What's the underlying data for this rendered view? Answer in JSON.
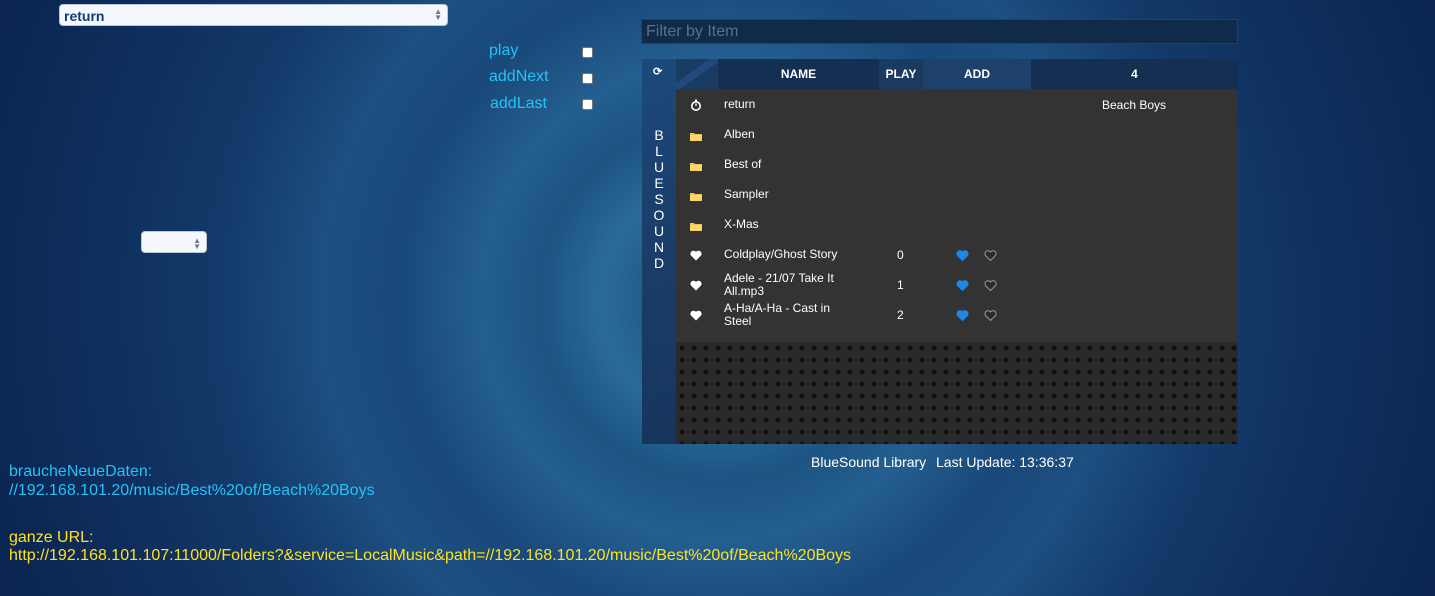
{
  "top_select": {
    "value": "return"
  },
  "small_select": {
    "value": ""
  },
  "options": [
    {
      "label": "play"
    },
    {
      "label": "addNext"
    },
    {
      "label": "addLast"
    }
  ],
  "filter": {
    "placeholder": "Filter by Item"
  },
  "side_label": [
    "B",
    "L",
    "U",
    "E",
    "S",
    "O",
    "U",
    "N",
    "D"
  ],
  "table": {
    "headers": {
      "name": "NAME",
      "play": "PLAY",
      "add": "ADD",
      "count": "4"
    },
    "rows": [
      {
        "icon": "stopwatch-icon",
        "name": "return",
        "play": "",
        "extra": "Beach Boys",
        "actions": false
      },
      {
        "icon": "folder-icon",
        "name": "Alben",
        "play": "",
        "extra": "",
        "actions": false
      },
      {
        "icon": "folder-icon",
        "name": "Best of",
        "play": "",
        "extra": "",
        "actions": false
      },
      {
        "icon": "folder-icon",
        "name": "Sampler",
        "play": "",
        "extra": "",
        "actions": false
      },
      {
        "icon": "folder-icon",
        "name": "X-Mas",
        "play": "",
        "extra": "",
        "actions": false
      },
      {
        "icon": "heart-icon",
        "name": "Coldplay/Ghost Story",
        "play": "0",
        "extra": "",
        "actions": true
      },
      {
        "icon": "heart-icon",
        "name": "Adele - 21/07 Take It All.mp3",
        "play": "1",
        "extra": "",
        "actions": true
      },
      {
        "icon": "heart-icon",
        "name": "A-Ha/A-Ha - Cast in Steel",
        "play": "2",
        "extra": "",
        "actions": true
      }
    ]
  },
  "footer": {
    "library": "BlueSound Library",
    "last_update": "Last Update: 13:36:37"
  },
  "info": {
    "brauche_label": "braucheNeueDaten:",
    "brauche_value": "//192.168.101.20/music/Best%20of/Beach%20Boys",
    "url_label": "ganze URL:",
    "url_value": "http://192.168.101.107:11000/Folders?&service=LocalMusic&path=//192.168.101.20/music/Best%20of/Beach%20Boys"
  }
}
